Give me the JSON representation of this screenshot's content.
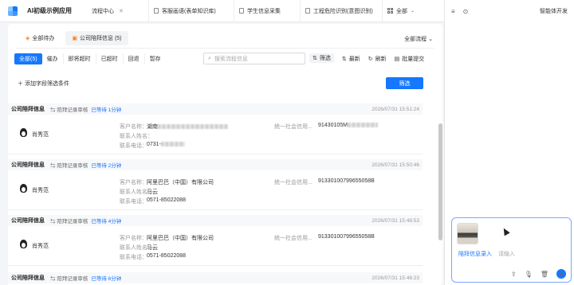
{
  "app": {
    "title": "AI初级示例应用"
  },
  "nav_tabs": [
    {
      "label": "流程中心"
    },
    {
      "label": "客服画语(表单知识库)"
    },
    {
      "label": "学生信息采集"
    },
    {
      "label": "工程危险识别(意图识别)"
    },
    {
      "label": "全部"
    }
  ],
  "right_panel": {
    "title": "智能体开发",
    "chat": {
      "tag": "陪拜信息录入",
      "placeholder": "请输入",
      "send_glyph": "➤"
    }
  },
  "main": {
    "subtabs": [
      {
        "label": "全部待办",
        "icon": "list-icon"
      },
      {
        "label": "公司陪拜信息 (5)",
        "icon": "doc-icon"
      }
    ],
    "all_flow": "全部流程",
    "filters": [
      "全部(5)",
      "催办",
      "即将超时",
      "已超时",
      "回退",
      "暂存"
    ],
    "search_placeholder": "搜索流程信息",
    "tools": [
      "筛选",
      "最新",
      "刷新",
      "批量提交"
    ],
    "add_condition": "添加字段筛选条件",
    "filter_button": "筛选"
  },
  "cards": [
    {
      "title": "公司陪拜信息",
      "step": "陪拜记录审核",
      "wait": "已等待 1分钟",
      "time": "2026/07/31 15:51:24",
      "person": "肖秀范",
      "customer_label": "客户名称：",
      "customer_value": "湖南",
      "contact_label": "联系人姓名：",
      "contact_value": "",
      "phone_label": "联系电话：",
      "phone_value": "0731-",
      "credit_label": "统一社会信用...",
      "credit_value": "91430105M"
    },
    {
      "title": "公司陪拜信息",
      "step": "陪拜记录审核",
      "wait": "已等待 2分钟",
      "time": "2026/07/31 15:50:46",
      "person": "肖秀范",
      "customer_label": "客户名称：",
      "customer_value": "阿里巴巴（中国）有限公司",
      "contact_label": "联系人姓名：",
      "contact_value": "马云",
      "phone_label": "联系电话：",
      "phone_value": "0571-85022088",
      "credit_label": "统一社会信用...",
      "credit_value": "91330100799655058B"
    },
    {
      "title": "公司陪拜信息",
      "step": "陪拜记录审核",
      "wait": "已等待 4分钟",
      "time": "2026/07/31 15:48:53",
      "person": "肖秀范",
      "customer_label": "客户名称：",
      "customer_value": "阿里巴巴（中国）有限公司",
      "contact_label": "联系人姓名：",
      "contact_value": "马云",
      "phone_label": "联系电话：",
      "phone_value": "0571-85022088",
      "credit_label": "统一社会信用...",
      "credit_value": "91330100799655058B"
    },
    {
      "title": "公司陪拜信息",
      "step": "陪拜记录审核",
      "wait": "已等待 6分钟",
      "time": "2026/07/31 15:46:23",
      "person": "",
      "customer_label": "",
      "customer_value": "",
      "contact_label": "",
      "contact_value": "",
      "phone_label": "",
      "phone_value": "",
      "credit_label": "",
      "credit_value": ""
    }
  ]
}
